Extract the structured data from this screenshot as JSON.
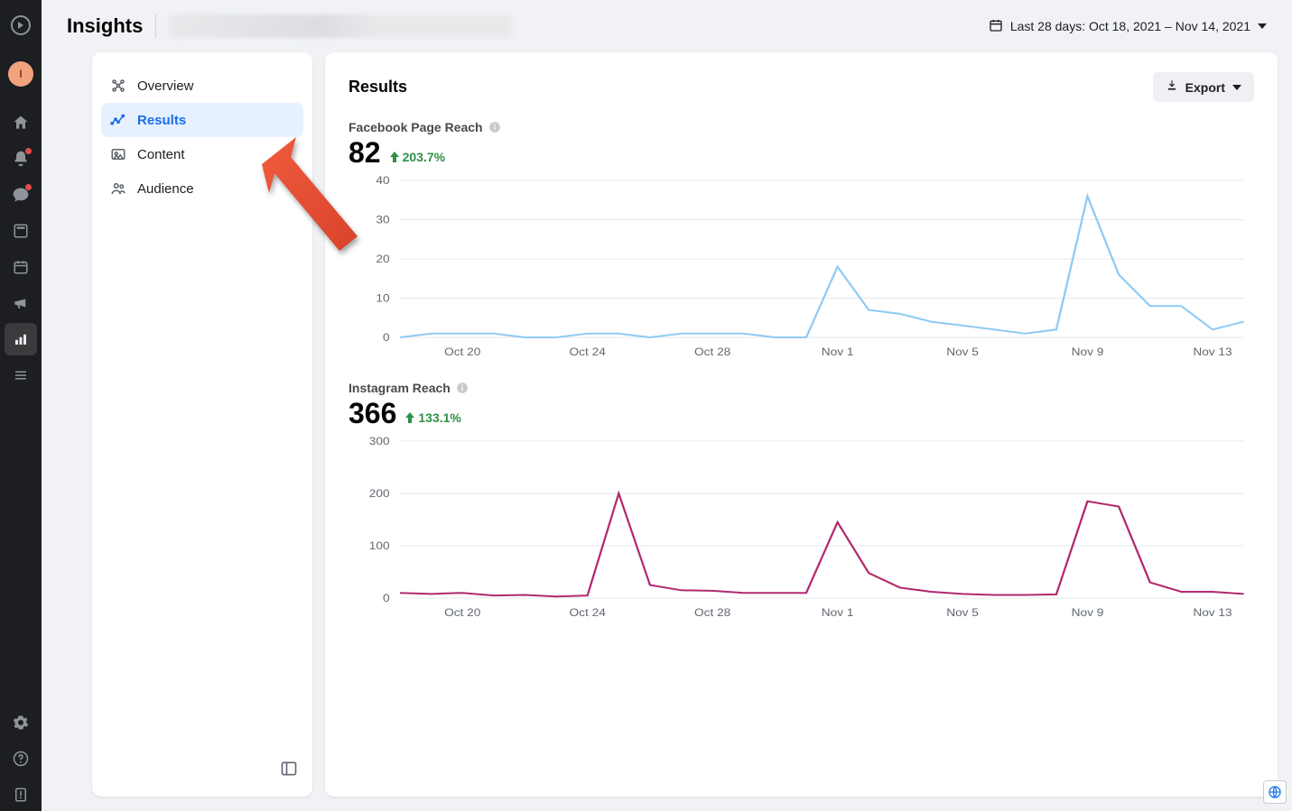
{
  "rail": {
    "avatar_initial": "I"
  },
  "topbar": {
    "title": "Insights",
    "date_range_label": "Last 28 days: Oct 18, 2021 – Nov 14, 2021"
  },
  "nav": {
    "items": [
      {
        "id": "overview",
        "label": "Overview"
      },
      {
        "id": "results",
        "label": "Results"
      },
      {
        "id": "content",
        "label": "Content"
      },
      {
        "id": "audience",
        "label": "Audience"
      }
    ],
    "selected": "results"
  },
  "main": {
    "heading": "Results",
    "export_label": "Export",
    "metrics": {
      "facebook_reach": {
        "title": "Facebook Page Reach",
        "value": "82",
        "delta": "203.7%"
      },
      "instagram_reach": {
        "title": "Instagram Reach",
        "value": "366",
        "delta": "133.1%"
      }
    }
  },
  "chart_data": [
    {
      "type": "line",
      "title": "Facebook Page Reach",
      "xlabel": "",
      "ylabel": "",
      "ylim": [
        0,
        40
      ],
      "yticks": [
        0,
        10,
        20,
        30,
        40
      ],
      "xticks": [
        "Oct 20",
        "Oct 24",
        "Oct 28",
        "Nov 1",
        "Nov 5",
        "Nov 9",
        "Nov 13"
      ],
      "x": [
        "Oct 18",
        "Oct 19",
        "Oct 20",
        "Oct 21",
        "Oct 22",
        "Oct 23",
        "Oct 24",
        "Oct 25",
        "Oct 26",
        "Oct 27",
        "Oct 28",
        "Oct 29",
        "Oct 30",
        "Oct 31",
        "Nov 1",
        "Nov 2",
        "Nov 3",
        "Nov 4",
        "Nov 5",
        "Nov 6",
        "Nov 7",
        "Nov 8",
        "Nov 9",
        "Nov 10",
        "Nov 11",
        "Nov 12",
        "Nov 13",
        "Nov 14"
      ],
      "series": [
        {
          "name": "Facebook Page Reach",
          "color": "#8fcaf4",
          "values": [
            0,
            1,
            1,
            1,
            0,
            0,
            1,
            1,
            0,
            1,
            1,
            1,
            0,
            0,
            18,
            7,
            6,
            4,
            3,
            2,
            1,
            2,
            36,
            16,
            8,
            8,
            2,
            4
          ]
        }
      ]
    },
    {
      "type": "line",
      "title": "Instagram Reach",
      "xlabel": "",
      "ylabel": "",
      "ylim": [
        0,
        300
      ],
      "yticks": [
        0,
        100,
        200,
        300
      ],
      "xticks": [
        "Oct 20",
        "Oct 24",
        "Oct 28",
        "Nov 1",
        "Nov 5",
        "Nov 9",
        "Nov 13"
      ],
      "x": [
        "Oct 18",
        "Oct 19",
        "Oct 20",
        "Oct 21",
        "Oct 22",
        "Oct 23",
        "Oct 24",
        "Oct 25",
        "Oct 26",
        "Oct 27",
        "Oct 28",
        "Oct 29",
        "Oct 30",
        "Oct 31",
        "Nov 1",
        "Nov 2",
        "Nov 3",
        "Nov 4",
        "Nov 5",
        "Nov 6",
        "Nov 7",
        "Nov 8",
        "Nov 9",
        "Nov 10",
        "Nov 11",
        "Nov 12",
        "Nov 13",
        "Nov 14"
      ],
      "series": [
        {
          "name": "Instagram Reach",
          "color": "#b1296f",
          "values": [
            10,
            8,
            10,
            5,
            6,
            3,
            5,
            200,
            25,
            15,
            14,
            10,
            10,
            10,
            145,
            48,
            20,
            12,
            8,
            6,
            6,
            7,
            185,
            175,
            30,
            12,
            12,
            8
          ]
        }
      ]
    }
  ]
}
